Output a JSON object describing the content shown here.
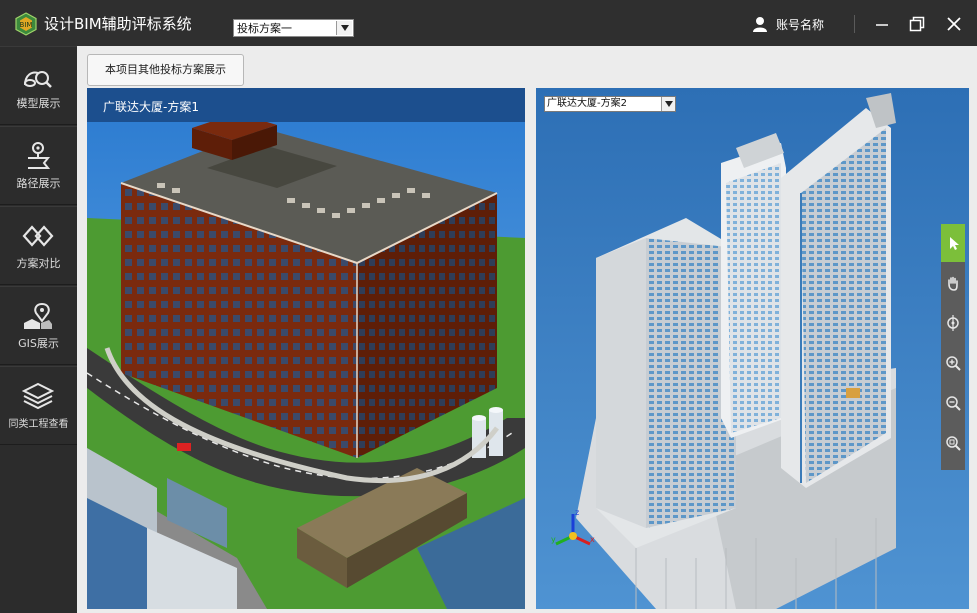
{
  "app": {
    "title": "设计BIM辅助评标系统",
    "scheme_select": "投标方案一",
    "user_name": "账号名称"
  },
  "sidebar": {
    "items": [
      {
        "label": "模型展示",
        "icon": "model-view-icon"
      },
      {
        "label": "路径展示",
        "icon": "route-icon"
      },
      {
        "label": "方案对比",
        "icon": "compare-icon"
      },
      {
        "label": "GIS展示",
        "icon": "gis-icon"
      },
      {
        "label": "同类工程查看",
        "icon": "layers-icon"
      }
    ]
  },
  "content": {
    "other_scheme_button": "本项目其他投标方案展示",
    "left_viewer_title": "广联达大厦-方案1",
    "right_viewer_select": "广联达大厦-方案2"
  },
  "toolbar": {
    "tools": [
      "select-cursor-icon",
      "pan-hand-icon",
      "orbit-icon",
      "zoom-in-icon",
      "zoom-out-icon",
      "zoom-fit-icon"
    ]
  },
  "colors": {
    "titlebar": "#2f2f2f",
    "sidebar": "#2c2c2c",
    "viewer_header": "#1c4f8e",
    "active_tool": "#7cbf3a"
  }
}
